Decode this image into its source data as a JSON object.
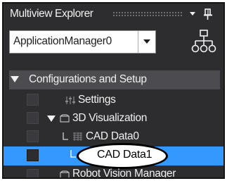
{
  "panel": {
    "title": "Multiview Explorer"
  },
  "dropdown": {
    "value": "ApplicationManager0"
  },
  "tree": {
    "root_label": "Configurations and Setup",
    "items": [
      {
        "label": "Settings",
        "icon": "settings-icon"
      },
      {
        "label": "3D Visualization",
        "icon": "folder-icon"
      },
      {
        "label": "CAD Data0",
        "icon": "cad-data-icon"
      },
      {
        "label": "CAD Data1",
        "icon": "cad-data-icon",
        "selected": true
      },
      {
        "label": "Robot Vision Manager",
        "icon": "folder-icon"
      }
    ]
  },
  "colors": {
    "panel_bg": "#2d2d30",
    "root_row_bg": "#4b4b50",
    "selection": "#3399ff",
    "text": "#f1f1f1",
    "callout_border": "#000000"
  }
}
